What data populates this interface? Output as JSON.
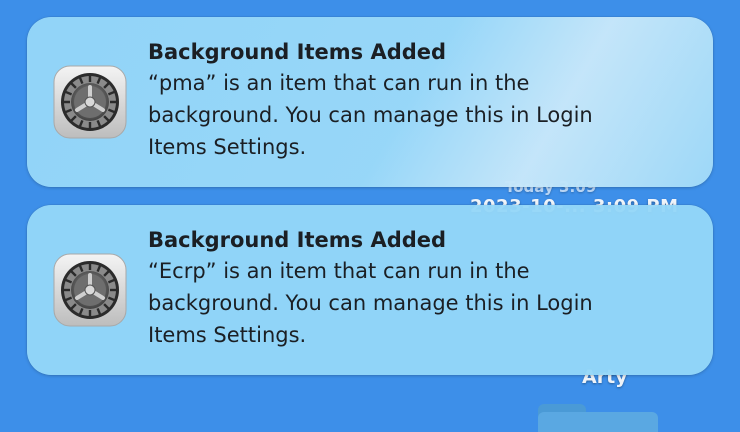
{
  "desktop": {
    "date_text": "Today 3:09",
    "time_text": "2023-10-... 3:09 PM",
    "folder_label": "Arty"
  },
  "notifications": [
    {
      "app_icon": "system-settings-gear-icon",
      "title": "Background Items Added",
      "message_lines": [
        "“pma” is an item that can run in the",
        "background. You can manage this in Login",
        "Items Settings."
      ]
    },
    {
      "app_icon": "system-settings-gear-icon",
      "title": "Background Items Added",
      "message_lines": [
        "“Ecrp” is an item that can run in the",
        "background. You can manage this in Login",
        "Items Settings."
      ]
    }
  ],
  "colors": {
    "desktop_background": "#3d8fe9",
    "notification_background": "#94d6f8",
    "text": "#1b1f24"
  }
}
